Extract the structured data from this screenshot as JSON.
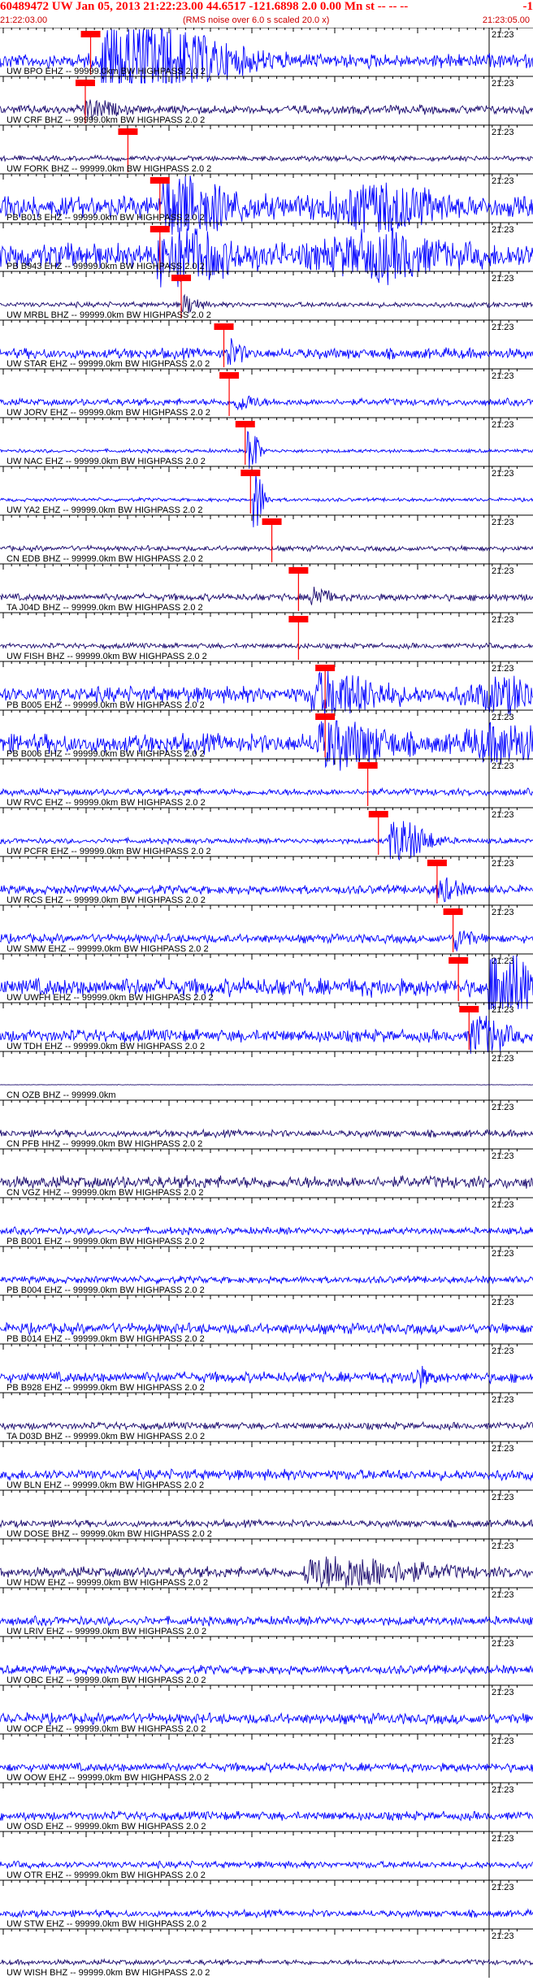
{
  "header": {
    "title": "60489472 UW Jan 05, 2013 21:22:23.00   44.6517 -121.6898  2.0 0.00 Mn st -- -- --",
    "end_mark": "-1",
    "start_time": "21:22:03.00",
    "note": "(RMS noise over 6.0 s scaled 20.0 x)",
    "end_time": "21:23:05.00"
  },
  "minute_label": "21:23",
  "colors": {
    "trace_blue": "#0000ff",
    "trace_dark": "#1a0a6e",
    "pick_red": "#ff0000",
    "header_red": "#ff0000",
    "axis": "#000000"
  },
  "traces": [
    {
      "label": "UW BPO EHZ -- 99999.0km BW  HIGHPASS  2.0  2",
      "color": "blue",
      "amp": 8,
      "pick": 0.17,
      "burst_center": 0.25,
      "burst_amp": 45,
      "burst_width": 0.2,
      "clip": true
    },
    {
      "label": "UW CRF BHZ -- 99999.0km BW  HIGHPASS  2.0  2",
      "color": "dark",
      "amp": 5,
      "pick": 0.16,
      "burst_center": 0.17,
      "burst_amp": 10,
      "burst_width": 0.05
    },
    {
      "label": "UW FORK BHZ -- 99999.0km BW  HIGHPASS  2.0  2",
      "color": "dark",
      "amp": 3,
      "pick": 0.24
    },
    {
      "label": "PB B013 EHZ -- 99999.0km BW  HIGHPASS  2.0  2",
      "color": "blue",
      "amp": 12,
      "pick": 0.3,
      "burst_center": 0.34,
      "burst_amp": 30,
      "burst_width": 0.12,
      "burst2_center": 0.72,
      "burst2_amp": 22,
      "burst2_width": 0.12
    },
    {
      "label": "PB B943 EHZ -- 99999.0km BW  HIGHPASS  2.0  2",
      "color": "blue",
      "amp": 14,
      "pick": 0.3,
      "burst_center": 0.33,
      "burst_amp": 26,
      "burst_width": 0.12,
      "burst2_center": 0.72,
      "burst2_amp": 20,
      "burst2_width": 0.12
    },
    {
      "label": "UW MRBL BHZ -- 99999.0km BW  HIGHPASS  2.0  2",
      "color": "dark",
      "amp": 3,
      "pick": 0.34,
      "burst_center": 0.35,
      "burst_amp": 10,
      "burst_width": 0.03
    },
    {
      "label": "UW STAR EHZ -- 99999.0km BW  HIGHPASS  2.0  2",
      "color": "blue",
      "amp": 6,
      "pick": 0.42,
      "burst_center": 0.43,
      "burst_amp": 14,
      "burst_width": 0.03
    },
    {
      "label": "UW JORV EHZ -- 99999.0km BW  HIGHPASS  2.0  2",
      "color": "blue",
      "amp": 4,
      "pick": 0.43,
      "burst_center": 0.45,
      "burst_amp": 8,
      "burst_width": 0.04
    },
    {
      "label": "UW NAC EHZ -- 99999.0km BW  HIGHPASS  2.0  2",
      "color": "blue",
      "amp": 2,
      "pick": 0.46,
      "burst_center": 0.47,
      "burst_amp": 30,
      "burst_width": 0.02
    },
    {
      "label": "UW YA2 EHZ -- 99999.0km BW  HIGHPASS  2.0  2",
      "color": "blue",
      "amp": 2,
      "pick": 0.47,
      "burst_center": 0.48,
      "burst_amp": 36,
      "burst_width": 0.02
    },
    {
      "label": "CN EDB BHZ -- 99999.0km BW  HIGHPASS  2.0  2",
      "color": "dark",
      "amp": 3,
      "pick": 0.51
    },
    {
      "label": "TA J04D BHZ -- 99999.0km BW  HIGHPASS  2.0  2",
      "color": "dark",
      "amp": 4,
      "pick": 0.56,
      "burst_center": 0.59,
      "burst_amp": 14,
      "burst_width": 0.03
    },
    {
      "label": "UW FISH BHZ -- 99999.0km BW  HIGHPASS  2.0  2",
      "color": "dark",
      "amp": 3,
      "pick": 0.56
    },
    {
      "label": "PB B005 EHZ -- 99999.0km BW  HIGHPASS  2.0  2",
      "color": "blue",
      "amp": 9,
      "pick": 0.61,
      "burst_center": 0.62,
      "burst_amp": 22,
      "burst_width": 0.12,
      "burst2_center": 0.95,
      "burst2_amp": 16,
      "burst2_width": 0.08
    },
    {
      "label": "PB B006 EHZ -- 99999.0km BW  HIGHPASS  2.0  2",
      "color": "blue",
      "amp": 11,
      "pick": 0.61,
      "burst_center": 0.63,
      "burst_amp": 22,
      "burst_width": 0.12,
      "burst2_center": 0.95,
      "burst2_amp": 18,
      "burst2_width": 0.08
    },
    {
      "label": "UW RVC EHZ -- 99999.0km BW  HIGHPASS  2.0  2",
      "color": "blue",
      "amp": 4,
      "pick": 0.69
    },
    {
      "label": "UW PCFR EHZ -- 99999.0km BW  HIGHPASS  2.0  2",
      "color": "blue",
      "amp": 3,
      "pick": 0.71,
      "burst_center": 0.75,
      "burst_amp": 24,
      "burst_width": 0.07
    },
    {
      "label": "UW RCS EHZ -- 99999.0km BW  HIGHPASS  2.0  2",
      "color": "blue",
      "amp": 5,
      "pick": 0.82,
      "burst_center": 0.83,
      "burst_amp": 12,
      "burst_width": 0.04
    },
    {
      "label": "UW SMW EHZ -- 99999.0km BW  HIGHPASS  2.0  2",
      "color": "blue",
      "amp": 5,
      "pick": 0.85,
      "burst_center": 0.86,
      "burst_amp": 12,
      "burst_width": 0.03
    },
    {
      "label": "UW UWFH EHZ -- 99999.0km BW  HIGHPASS  2.0  2",
      "color": "blue",
      "amp": 10,
      "pick": 0.86,
      "burst_center": 0.94,
      "burst_amp": 42,
      "burst_width": 0.08,
      "clip": true
    },
    {
      "label": "UW TDH EHZ -- 99999.0km BW  HIGHPASS  2.0  2",
      "color": "blue",
      "amp": 7,
      "pick": 0.88,
      "burst_center": 0.9,
      "burst_amp": 20,
      "burst_width": 0.06
    },
    {
      "label": "CN OZB BHZ -- 99999.0km",
      "color": "dark",
      "amp": 0.3
    },
    {
      "label": "CN PFB HHZ -- 99999.0km BW  HIGHPASS  2.0  2",
      "color": "dark",
      "amp": 4
    },
    {
      "label": "CN VGZ HHZ -- 99999.0km BW  HIGHPASS  2.0  2",
      "color": "dark",
      "amp": 7
    },
    {
      "label": "PB B001 EHZ -- 99999.0km BW  HIGHPASS  2.0  2",
      "color": "blue",
      "amp": 4
    },
    {
      "label": "PB B004 EHZ -- 99999.0km BW  HIGHPASS  2.0  2",
      "color": "blue",
      "amp": 4
    },
    {
      "label": "PB B014 EHZ -- 99999.0km BW  HIGHPASS  2.0  2",
      "color": "blue",
      "amp": 6
    },
    {
      "label": "PB B928 EHZ -- 99999.0km BW  HIGHPASS  2.0  2",
      "color": "blue",
      "amp": 6,
      "burst_center": 0.78,
      "burst_amp": 10,
      "burst_width": 0.03
    },
    {
      "label": "TA D03D BHZ -- 99999.0km BW  HIGHPASS  2.0  2",
      "color": "dark",
      "amp": 4
    },
    {
      "label": "UW BLN EHZ -- 99999.0km BW  HIGHPASS  2.0  2",
      "color": "blue",
      "amp": 6
    },
    {
      "label": "UW DOSE BHZ -- 99999.0km BW  HIGHPASS  2.0  2",
      "color": "dark",
      "amp": 4
    },
    {
      "label": "UW HDW EHZ -- 99999.0km BW  HIGHPASS  2.0  2",
      "color": "dark",
      "amp": 6,
      "burst_center": 0.63,
      "burst_amp": 16,
      "burst_width": 0.2
    },
    {
      "label": "UW LRIV EHZ -- 99999.0km BW  HIGHPASS  2.0  2",
      "color": "blue",
      "amp": 5
    },
    {
      "label": "UW OBC EHZ -- 99999.0km BW  HIGHPASS  2.0  2",
      "color": "blue",
      "amp": 5
    },
    {
      "label": "UW OCP EHZ -- 99999.0km BW  HIGHPASS  2.0  2",
      "color": "blue",
      "amp": 6
    },
    {
      "label": "UW OOW EHZ -- 99999.0km BW  HIGHPASS  2.0  2",
      "color": "blue",
      "amp": 5
    },
    {
      "label": "UW OSD EHZ -- 99999.0km BW  HIGHPASS  2.0  2",
      "color": "blue",
      "amp": 5
    },
    {
      "label": "UW OTR EHZ -- 99999.0km BW  HIGHPASS  2.0  2",
      "color": "blue",
      "amp": 4
    },
    {
      "label": "UW STW EHZ -- 99999.0km BW  HIGHPASS  2.0  2",
      "color": "blue",
      "amp": 4
    },
    {
      "label": "UW WISH BHZ -- 99999.0km BW  HIGHPASS  2.0  2",
      "color": "dark",
      "amp": 3
    }
  ]
}
